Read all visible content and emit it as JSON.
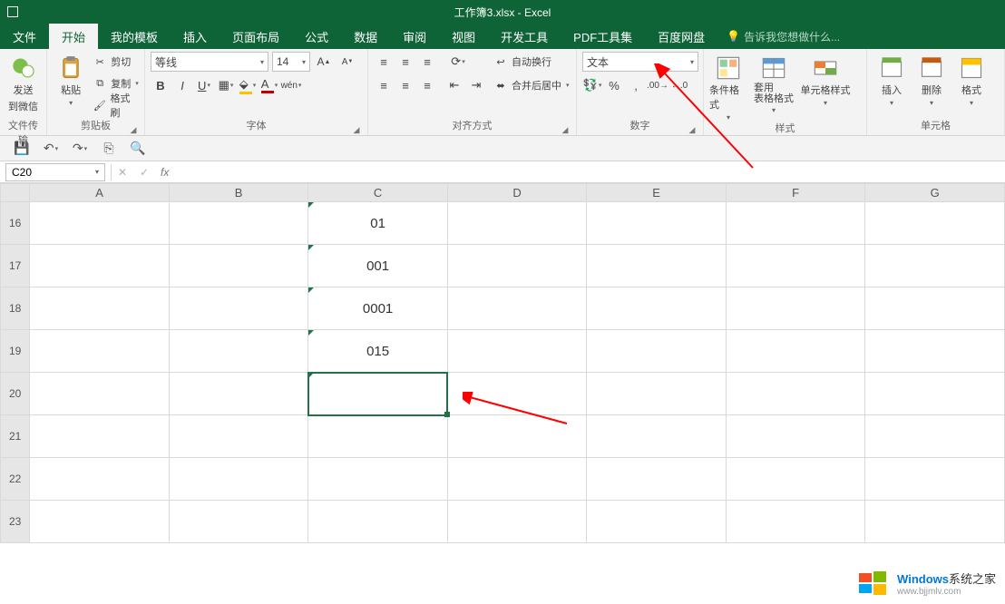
{
  "title": "工作簿3.xlsx - Excel",
  "tabs": [
    "文件",
    "开始",
    "我的模板",
    "插入",
    "页面布局",
    "公式",
    "数据",
    "审阅",
    "视图",
    "开发工具",
    "PDF工具集",
    "百度网盘"
  ],
  "active_tab": 1,
  "tell_me": "告诉我您想做什么...",
  "groups": {
    "wechat": {
      "send": "发送",
      "to": "到微信",
      "label": "文件传输"
    },
    "clipboard": {
      "paste": "粘贴",
      "cut": "剪切",
      "copy": "复制",
      "painter": "格式刷",
      "label": "剪贴板"
    },
    "font": {
      "name": "等线",
      "size": "14",
      "label": "字体"
    },
    "align": {
      "wrap": "自动换行",
      "merge": "合并后居中",
      "label": "对齐方式"
    },
    "number": {
      "format": "文本",
      "label": "数字"
    },
    "styles": {
      "cond": "条件格式",
      "table": "套用\n表格格式",
      "cell": "单元格样式",
      "label": "样式"
    },
    "cells": {
      "insert": "插入",
      "delete": "删除",
      "format": "格式",
      "label": "单元格"
    }
  },
  "namebox": "C20",
  "columns": [
    "A",
    "B",
    "C",
    "D",
    "E",
    "F",
    "G"
  ],
  "rows": [
    16,
    17,
    18,
    19,
    20,
    21,
    22,
    23
  ],
  "celldata": {
    "16": {
      "C": "01"
    },
    "17": {
      "C": "001"
    },
    "18": {
      "C": "0001"
    },
    "19": {
      "C": "015"
    }
  },
  "textcells": [
    "C16",
    "C17",
    "C18",
    "C19",
    "C20"
  ],
  "selected": "C20",
  "watermark": {
    "brand": "Windows",
    "brand2": "系统之家",
    "url": "www.bjjmlv.com"
  }
}
